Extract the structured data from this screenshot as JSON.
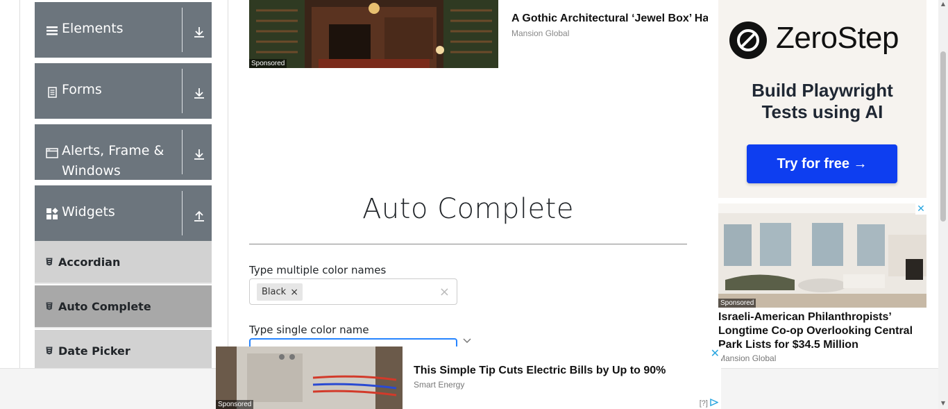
{
  "sidebar": {
    "groups": [
      {
        "label": "Elements",
        "icon": "hamburger-icon",
        "arrow": "download-arrow-icon"
      },
      {
        "label": "Forms",
        "icon": "document-icon",
        "arrow": "download-arrow-icon"
      },
      {
        "label": "Alerts, Frame & Windows",
        "icon": "window-icon",
        "arrow": "download-arrow-icon"
      },
      {
        "label": "Widgets",
        "icon": "widgets-icon",
        "arrow": "upload-arrow-icon"
      }
    ],
    "items": [
      {
        "label": "Accordian",
        "active": false
      },
      {
        "label": "Auto Complete",
        "active": true
      },
      {
        "label": "Date Picker",
        "active": false
      }
    ]
  },
  "top_ad": {
    "title": "A Gothic Architectural ‘Jewel Box’ Ha",
    "source": "Mansion Global",
    "sponsored": "Sponsored"
  },
  "main": {
    "title": "Auto Complete",
    "multi_label": "Type multiple color names",
    "multi_chip": "Black",
    "chip_remove": "×",
    "clear": "×",
    "single_label": "Type single color name"
  },
  "right_ad": {
    "brand": "ZeroStep",
    "headline_line1": "Build Playwright",
    "headline_line2": "Tests using AI",
    "cta": "Try for free →",
    "sponsored": "Sponsored",
    "close": "✕",
    "title": "Israeli-American Philanthropists’ Longtime Co-op Overlooking Central Park Lists for $34.5 Million",
    "source": "Mansion Global"
  },
  "bottom_ad": {
    "title": "This Simple Tip Cuts Electric Bills by Up to 90%",
    "source": "Smart Energy",
    "sponsored": "Sponsored",
    "close": "✕",
    "info": "[?]"
  },
  "colors": {
    "sidebar_header": "#6c757d",
    "menu_item": "#d2d2d2",
    "menu_item_active": "#a8a8a8",
    "cta_blue": "#0e3ef0",
    "focus_blue": "#2684ff"
  }
}
